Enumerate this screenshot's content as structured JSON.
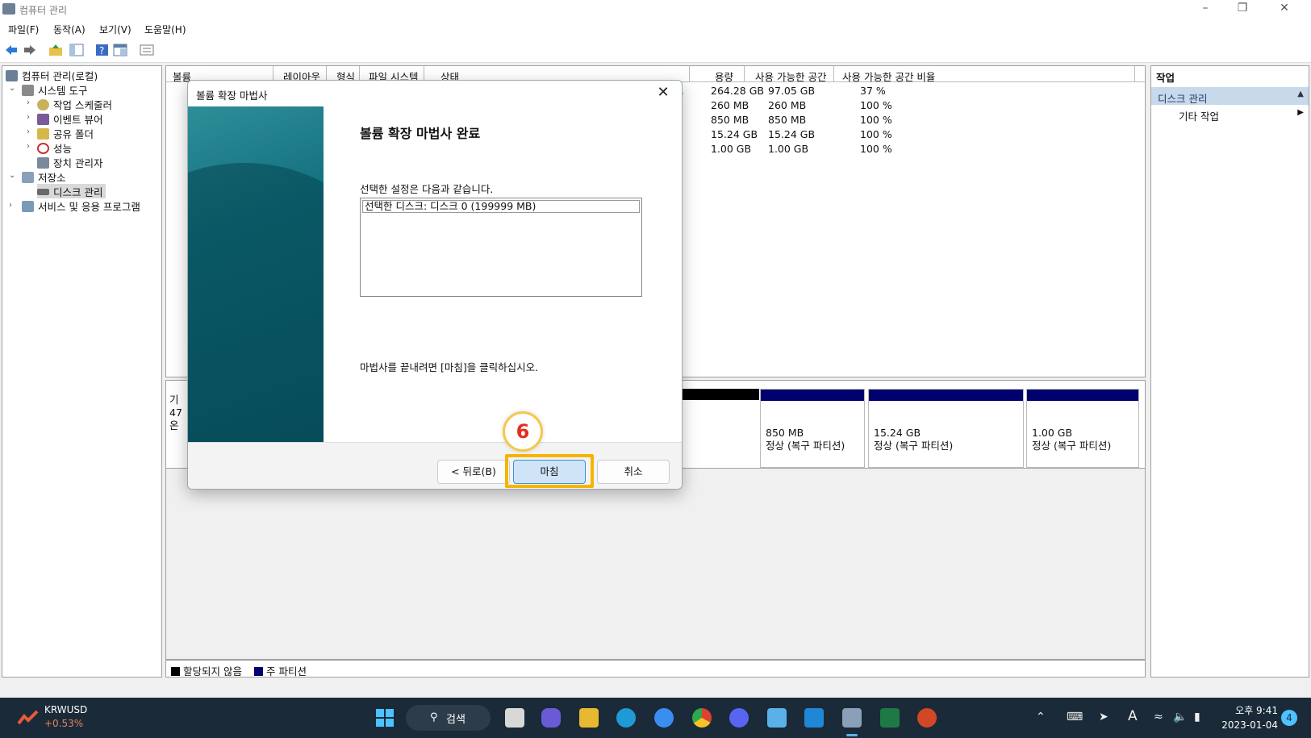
{
  "window": {
    "title": "컴퓨터 관리"
  },
  "menu": [
    "파일(F)",
    "동작(A)",
    "보기(V)",
    "도움말(H)"
  ],
  "toolbar_icons": [
    "back-arrow-icon",
    "forward-arrow-icon",
    "up-folder-icon",
    "show-tree-icon",
    "help-icon",
    "console-icon",
    "properties-icon"
  ],
  "tree": {
    "root": "컴퓨터 관리(로컬)",
    "system_tools": "시스템 도구",
    "task_scheduler": "작업 스케줄러",
    "event_viewer": "이벤트 뷰어",
    "shared_folders": "공유 폴더",
    "performance": "성능",
    "device_manager": "장치 관리자",
    "storage": "저장소",
    "disk_management": "디스크 관리",
    "services": "서비스 및 응용 프로그램"
  },
  "volume_list": {
    "columns": [
      "볼륨",
      "레이아웃",
      "형식",
      "파일 시스템",
      "상태",
      "용량",
      "사용 가능한 공간",
      "사용 가능한 공간 비율"
    ],
    "rows": [
      {
        "status_tail": "션)",
        "capacity": "264.28 GB",
        "free": "97.05 GB",
        "pct": "37 %"
      },
      {
        "status_tail": "",
        "capacity": "260 MB",
        "free": "260 MB",
        "pct": "100 %"
      },
      {
        "status_tail": "",
        "capacity": "850 MB",
        "free": "850 MB",
        "pct": "100 %"
      },
      {
        "status_tail": "",
        "capacity": "15.24 GB",
        "free": "15.24 GB",
        "pct": "100 %"
      },
      {
        "status_tail": "",
        "capacity": "1.00 GB",
        "free": "1.00 GB",
        "pct": "100 %"
      }
    ]
  },
  "disk_pane": {
    "label_fragments": [
      "기",
      "47",
      "온"
    ],
    "partitions": [
      {
        "size": "850 MB",
        "status": "정상 (복구 파티션)"
      },
      {
        "size": "15.24 GB",
        "status": "정상 (복구 파티션)"
      },
      {
        "size": "1.00 GB",
        "status": "정상 (복구 파티션)"
      }
    ]
  },
  "legend": {
    "unallocated": "할당되지 않음",
    "primary": "주 파티션"
  },
  "actions": {
    "header": "작업",
    "section": "디스크 관리",
    "more": "기타 작업"
  },
  "dialog": {
    "title": "볼륨 확장 마법사",
    "heading": "볼륨 확장 마법사 완료",
    "subtitle": "선택한 설정은 다음과 같습니다.",
    "selected_line": "선택한 디스크: 디스크 0 (199999 MB)",
    "note": "마법사를 끝내려면 [마침]을 클릭하십시오.",
    "back_button": "< 뒤로(B)",
    "finish_button": "마침",
    "cancel_button": "취소"
  },
  "annotation": {
    "step": "6"
  },
  "taskbar": {
    "stock_name": "KRWUSD",
    "stock_change": "+0.53%",
    "search": "검색",
    "time": "오후 9:41",
    "date": "2023-01-04",
    "notification_count": "4",
    "ime": "A"
  },
  "colors": {
    "primary_partition": "#00006e",
    "highlight": "#f5b400",
    "step_text": "#e0301e"
  }
}
